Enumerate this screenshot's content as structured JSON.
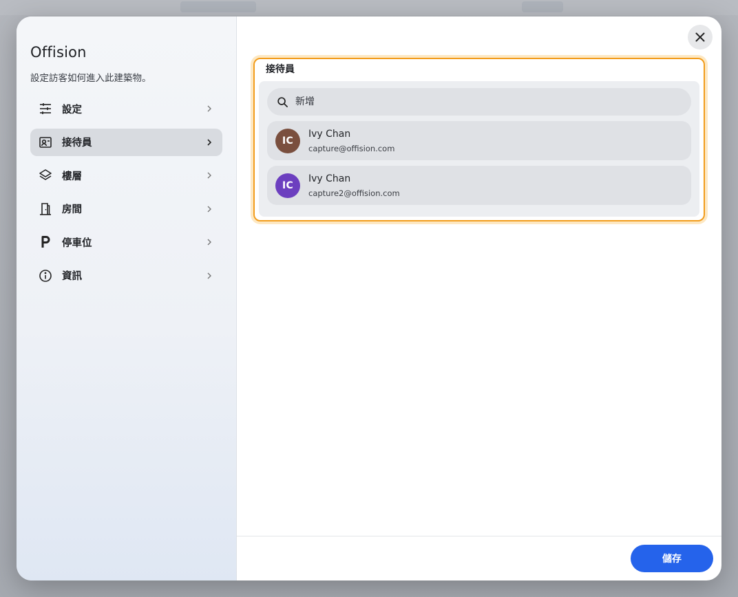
{
  "sidebar": {
    "title": "Offision",
    "subtitle": "設定訪客如何進入此建築物。",
    "items": [
      {
        "label": "設定",
        "icon": "sliders-icon"
      },
      {
        "label": "接待員",
        "icon": "contact-card-icon"
      },
      {
        "label": "樓層",
        "icon": "layers-icon"
      },
      {
        "label": "房間",
        "icon": "door-icon"
      },
      {
        "label": "停車位",
        "icon": "parking-icon"
      },
      {
        "label": "資訊",
        "icon": "info-icon"
      }
    ],
    "active_index": 1
  },
  "main": {
    "section_title": "接待員",
    "search": {
      "placeholder": "新增",
      "value": ""
    },
    "receptionists": [
      {
        "initials": "IC",
        "name": "Ivy Chan",
        "email": "capture@offision.com",
        "avatar_color": "#7a4f3e"
      },
      {
        "initials": "IC",
        "name": "Ivy Chan",
        "email": "capture2@offision.com",
        "avatar_color": "#6c3fbf"
      }
    ]
  },
  "footer": {
    "save_label": "儲存"
  },
  "colors": {
    "accent": "#2563eb",
    "highlight": "#f29c1b"
  }
}
